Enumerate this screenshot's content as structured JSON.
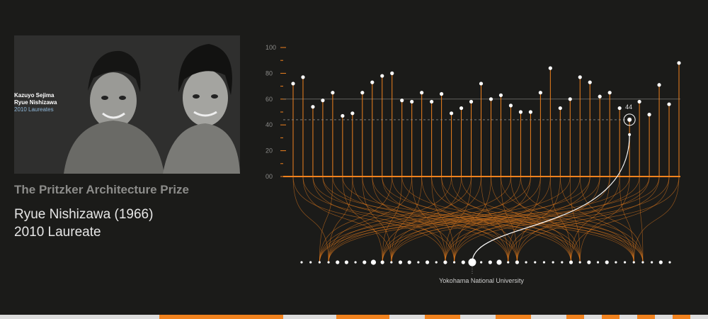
{
  "photo": {
    "caption_names": [
      "Kazuyo Sejima",
      "Ryue Nishizawa"
    ],
    "caption_year": "2010 Laureates"
  },
  "prize_title": "The Pritzker Architecture Prize",
  "laureate": {
    "name": "Ryue Nishizawa (1966)",
    "year_label": "2010 Laureate"
  },
  "school_label": "Yokohama National University",
  "colors": {
    "accent": "#f0821e",
    "background": "#1b1b19",
    "caption_blue": "#8fb7d8"
  },
  "bottom_bar_segments": [
    {
      "from": 0.225,
      "to": 0.4
    },
    {
      "from": 0.475,
      "to": 0.55
    },
    {
      "from": 0.6,
      "to": 0.65
    },
    {
      "from": 0.7,
      "to": 0.75
    },
    {
      "from": 0.8,
      "to": 0.825
    },
    {
      "from": 0.85,
      "to": 0.875
    },
    {
      "from": 0.9,
      "to": 0.925
    },
    {
      "from": 0.95,
      "to": 0.975
    }
  ],
  "chart_data": {
    "type": "lollipop",
    "ylim": [
      0,
      100
    ],
    "yticks": [
      0,
      20,
      40,
      60,
      80,
      100
    ],
    "ytick_labels": [
      "00",
      "20",
      "40",
      "60",
      "80",
      "100"
    ],
    "reference_line": 60,
    "values": [
      72,
      77,
      54,
      59,
      65,
      47,
      49,
      65,
      73,
      78,
      80,
      59,
      58,
      65,
      58,
      64,
      49,
      53,
      58,
      72,
      60,
      63,
      55,
      50,
      50,
      65,
      84,
      53,
      60,
      77,
      73,
      62,
      65,
      53,
      44,
      58,
      48,
      71,
      56,
      88
    ],
    "highlight": {
      "index": 34,
      "label": "44"
    },
    "schools": [
      {
        "size": 1
      },
      {
        "size": 1
      },
      {
        "size": 1
      },
      {
        "size": 1
      },
      {
        "size": 2
      },
      {
        "size": 2
      },
      {
        "size": 1
      },
      {
        "size": 2
      },
      {
        "size": 3
      },
      {
        "size": 2
      },
      {
        "size": 1
      },
      {
        "size": 2
      },
      {
        "size": 2
      },
      {
        "size": 1
      },
      {
        "size": 2
      },
      {
        "size": 1
      },
      {
        "size": 2
      },
      {
        "size": 1
      },
      {
        "size": 2
      },
      {
        "size": 5
      },
      {
        "size": 1
      },
      {
        "size": 2
      },
      {
        "size": 3
      },
      {
        "size": 1
      },
      {
        "size": 2
      },
      {
        "size": 1
      },
      {
        "size": 1
      },
      {
        "size": 1
      },
      {
        "size": 1
      },
      {
        "size": 1
      },
      {
        "size": 2
      },
      {
        "size": 1
      },
      {
        "size": 2
      },
      {
        "size": 1
      },
      {
        "size": 2
      },
      {
        "size": 1
      },
      {
        "size": 1
      },
      {
        "size": 1
      },
      {
        "size": 1
      },
      {
        "size": 1
      },
      {
        "size": 2
      },
      {
        "size": 1
      }
    ],
    "highlight_school_index": 19
  }
}
